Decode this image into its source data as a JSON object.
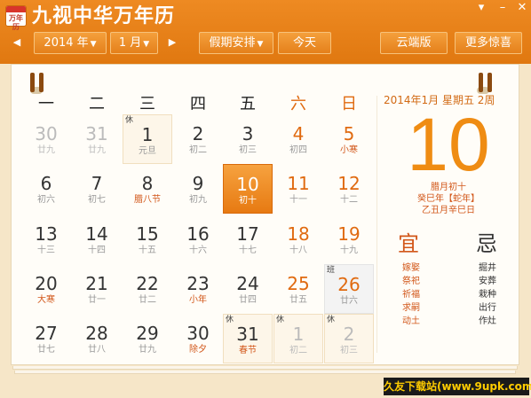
{
  "app": {
    "logo_text": "万年历",
    "title": "九视中华万年历"
  },
  "toolbar": {
    "prev_month": "◀",
    "next_month": "▶",
    "year": "2014 年",
    "month": "1 月",
    "holiday": "假期安排",
    "today": "今天",
    "cloud": "云端版",
    "more": "更多惊喜"
  },
  "window": {
    "menu": "▾",
    "minimize": "–",
    "close": "✕"
  },
  "weekdays": [
    "一",
    "二",
    "三",
    "四",
    "五",
    "六",
    "日"
  ],
  "days": [
    {
      "num": "30",
      "lunar": "廿九",
      "other": true
    },
    {
      "num": "31",
      "lunar": "廿九",
      "other": true
    },
    {
      "num": "1",
      "lunar": "元旦",
      "tag": "休",
      "holiday": true
    },
    {
      "num": "2",
      "lunar": "初二"
    },
    {
      "num": "3",
      "lunar": "初三"
    },
    {
      "num": "4",
      "lunar": "初四",
      "weekend": true
    },
    {
      "num": "5",
      "lunar": "小寒",
      "weekend": true,
      "festival": true
    },
    {
      "num": "6",
      "lunar": "初六"
    },
    {
      "num": "7",
      "lunar": "初七"
    },
    {
      "num": "8",
      "lunar": "腊八节",
      "festival": true
    },
    {
      "num": "9",
      "lunar": "初九"
    },
    {
      "num": "10",
      "lunar": "初十",
      "selected": true
    },
    {
      "num": "11",
      "lunar": "十一",
      "weekend": true
    },
    {
      "num": "12",
      "lunar": "十二",
      "weekend": true
    },
    {
      "num": "13",
      "lunar": "十三"
    },
    {
      "num": "14",
      "lunar": "十四"
    },
    {
      "num": "15",
      "lunar": "十五"
    },
    {
      "num": "16",
      "lunar": "十六"
    },
    {
      "num": "17",
      "lunar": "十七"
    },
    {
      "num": "18",
      "lunar": "十八",
      "weekend": true
    },
    {
      "num": "19",
      "lunar": "十九",
      "weekend": true
    },
    {
      "num": "20",
      "lunar": "大寒",
      "festival": true
    },
    {
      "num": "21",
      "lunar": "廿一"
    },
    {
      "num": "22",
      "lunar": "廿二"
    },
    {
      "num": "23",
      "lunar": "小年",
      "festival": true
    },
    {
      "num": "24",
      "lunar": "廿四"
    },
    {
      "num": "25",
      "lunar": "廿五",
      "weekend": true
    },
    {
      "num": "26",
      "lunar": "廿六",
      "weekend": true,
      "tag": "班",
      "workday": true
    },
    {
      "num": "27",
      "lunar": "廿七"
    },
    {
      "num": "28",
      "lunar": "廿八"
    },
    {
      "num": "29",
      "lunar": "廿九"
    },
    {
      "num": "30",
      "lunar": "除夕",
      "festival": true
    },
    {
      "num": "31",
      "lunar": "春节",
      "tag": "休",
      "holiday": true,
      "festival": true
    },
    {
      "num": "1",
      "lunar": "初二",
      "tag": "休",
      "holiday": true,
      "other": true
    },
    {
      "num": "2",
      "lunar": "初三",
      "tag": "休",
      "holiday": true,
      "other": true
    }
  ],
  "info": {
    "date_line": "2014年1月  星期五  2周",
    "big_day": "10",
    "lunar_1": "腊月初十",
    "lunar_2": "癸巳年【蛇年】",
    "lunar_3": "乙丑月辛巳日",
    "yi": "宜",
    "ji": "忌",
    "yi_items": [
      "嫁娶",
      "祭祀",
      "祈福",
      "求嗣",
      "动土"
    ],
    "ji_items": [
      "掘井",
      "安葬",
      "栽种",
      "出行",
      "作灶"
    ]
  },
  "watermark": "久友下载站(www.9upk.com)",
  "colors": {
    "titlebar": "#e98320",
    "accent": "#ef8c13",
    "festival": "#d2571a"
  }
}
